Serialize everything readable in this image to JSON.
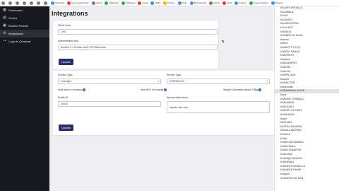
{
  "bookmarks": [
    {
      "label": "",
      "color": "g"
    },
    {
      "label": "",
      "color": "g"
    },
    {
      "label": "",
      "color": "g"
    },
    {
      "label": "",
      "color": "g"
    },
    {
      "label": "",
      "color": "g"
    },
    {
      "label": "",
      "color": "g"
    },
    {
      "label": "",
      "color": "g"
    },
    {
      "label": "WebStore",
      "color": "b"
    },
    {
      "label": "Dev Google Tasks",
      "color": "r"
    },
    {
      "label": "Github",
      "color": "g"
    },
    {
      "label": "Whatsapp",
      "color": "gr"
    },
    {
      "label": "Whatsapp",
      "color": "gr"
    },
    {
      "label": "Gmail",
      "color": "r"
    },
    {
      "label": "Tasks",
      "color": "b"
    },
    {
      "label": "Miniapp",
      "color": "y"
    },
    {
      "label": "Trello",
      "color": "b"
    },
    {
      "label": "MicrobiteSite",
      "color": "b"
    },
    {
      "label": "Github",
      "color": "g"
    },
    {
      "label": "Tools",
      "color": "r"
    },
    {
      "label": "Projects",
      "color": "b"
    },
    {
      "label": "Krogers Sheets",
      "color": "gr"
    },
    {
      "label": "Projects",
      "color": "b"
    }
  ],
  "sidebar": {
    "items": [
      {
        "label": "Dashboard",
        "icon": "dashboard-icon"
      },
      {
        "label": "Orders",
        "icon": "cart-icon"
      },
      {
        "label": "Booked Parcels",
        "icon": "box-icon"
      },
      {
        "label": "Integrations",
        "icon": "link-icon"
      },
      {
        "label": "Login to Quickeat",
        "icon": "login-icon"
      }
    ]
  },
  "page": {
    "title": "Integrations"
  },
  "card1": {
    "client_code_label": "Client Code",
    "client_code_value": "1901",
    "auth_key_label": "Authentication Key",
    "auth_key_value": "8cbe1cf 5 176-bdbc ae23-575755ecddda",
    "update_label": "Update"
  },
  "card2": {
    "product_type_label": "Product Type",
    "product_type_value": "Overnight",
    "service_type_label": "Service Type",
    "service_type_value": "OVERNIGHT",
    "hold_items_label": "Hold Items in remarks",
    "item_sku_label": "Item SKU in remarks",
    "weight_label": "Weight Calculated default 0.5kg",
    "profile_id_label": "Profile ID",
    "profile_id_value": "00000",
    "special_instr_label": "Special Instructions",
    "special_instr_value": "Handle with care",
    "update_label": "Update"
  },
  "list": {
    "items": [
      "KALARY MOHALLA",
      "KALAWALA",
      "KALAY",
      "KALANGO",
      "KALARI MOTAN",
      "KALIA KOT",
      "KAMALIA",
      "KAMBER ALI KHAN",
      "Kamoki",
      "Kamra",
      "KAMKOTTY (K.K)",
      "KANDAL RAHAN",
      "KANDHKOT",
      "Kandiaro",
      "KANDIANPUR",
      "KANDRA",
      "KANIYAL",
      "KAPPAL KAD",
      "Karachi",
      "KARAK PUR",
      "Karamwala",
      "KARAMWALA KHATA",
      "Karor",
      "KARORE TORWALA",
      "KARNABAG",
      "KAROONDI",
      "KAROR LAL ESAN",
      "KASAHDON",
      "Kasur",
      "KATLANG",
      "KATTHA SUGHRAL",
      "KAWALA MAJHAN",
      "KEHALA",
      "KHAIL",
      "KHAIR MOHAMMAD",
      "KHAIR WALA",
      "KHAIR SHADIPUR",
      "KHALMAN",
      "KHANQA KUNDIYA",
      "KHANEWAL",
      "KHANPUR MOHALLA",
      "KHANPUR RAHIM",
      "Khanpur",
      "KHANPUR NATHAN"
    ],
    "selected_index": 21
  }
}
